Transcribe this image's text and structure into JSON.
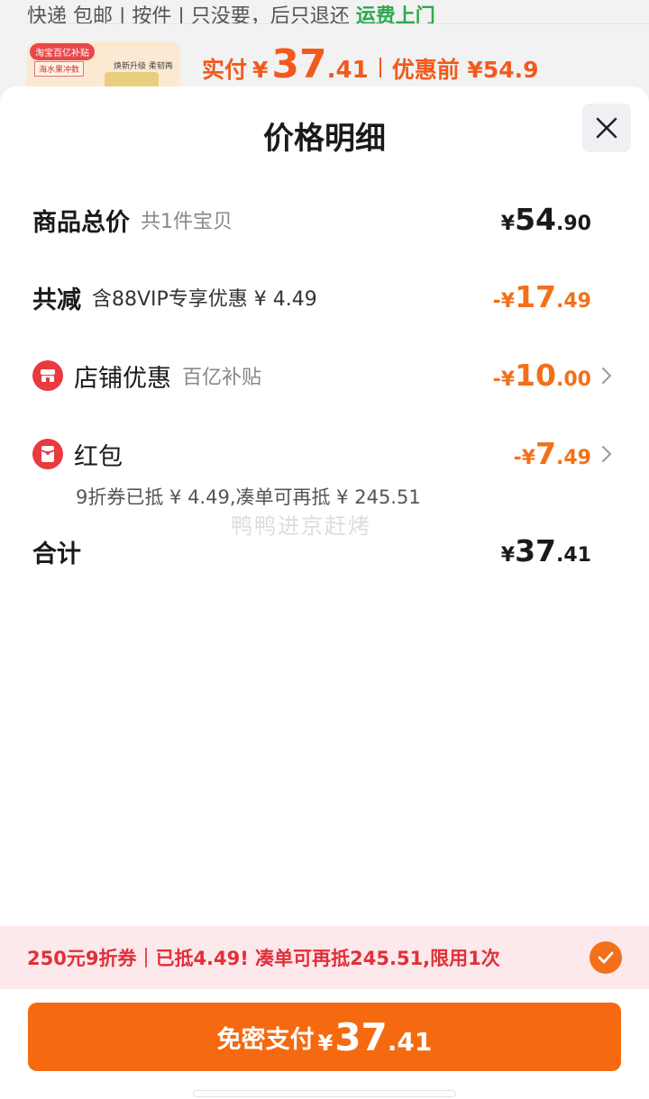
{
  "background": {
    "strip_text": "快递 包邮 | 按件 | 只没要，后只退还",
    "strip_green": "运费上门",
    "thumb_tag": "淘宝百亿补贴",
    "thumb_tag2": "海水果冲数",
    "thumb_tag3": "焕新升级 柔韧再进阶",
    "price_label": "实付",
    "price_yen": "¥",
    "price_int": "37",
    "price_dec": ".41",
    "prev_price": "优惠前 ¥54.9"
  },
  "sheet": {
    "title": "价格明细",
    "close_icon": "close-icon"
  },
  "rows": {
    "total": {
      "label": "商品总价",
      "sub": "共1件宝贝",
      "prefix": "¥",
      "int": "54",
      "dec": ".90"
    },
    "reduce": {
      "label": "共减",
      "sub": "含88VIP专享优惠 ¥ 4.49",
      "prefix": "-¥",
      "int": "17",
      "dec": ".49"
    },
    "store": {
      "icon": "store-icon",
      "label": "店铺优惠",
      "sub": "百亿补贴",
      "prefix": "-¥",
      "int": "10",
      "dec": ".00"
    },
    "redpacket": {
      "icon": "red-packet-icon",
      "label": "红包",
      "prefix": "-¥",
      "int": "7",
      "dec": ".49",
      "note": "9折券已抵 ¥ 4.49,凑单可再抵 ¥ 245.51"
    },
    "sum": {
      "label": "合计",
      "prefix": "¥",
      "int": "37",
      "dec": ".41"
    }
  },
  "watermark": "鸭鸭进京赶烤",
  "coupon": {
    "text": "250元9折券｜已抵4.49! 凑单可再抵245.51,限用1次",
    "checked": true
  },
  "pay": {
    "label": "免密支付",
    "prefix": "¥",
    "int": "37",
    "dec": ".41"
  },
  "colors": {
    "accent_orange": "#f56a10",
    "discount_orange": "#f2701a",
    "coupon_red": "#e0303a",
    "coupon_bg": "#fde8eb",
    "store_red": "#e83a3f"
  }
}
